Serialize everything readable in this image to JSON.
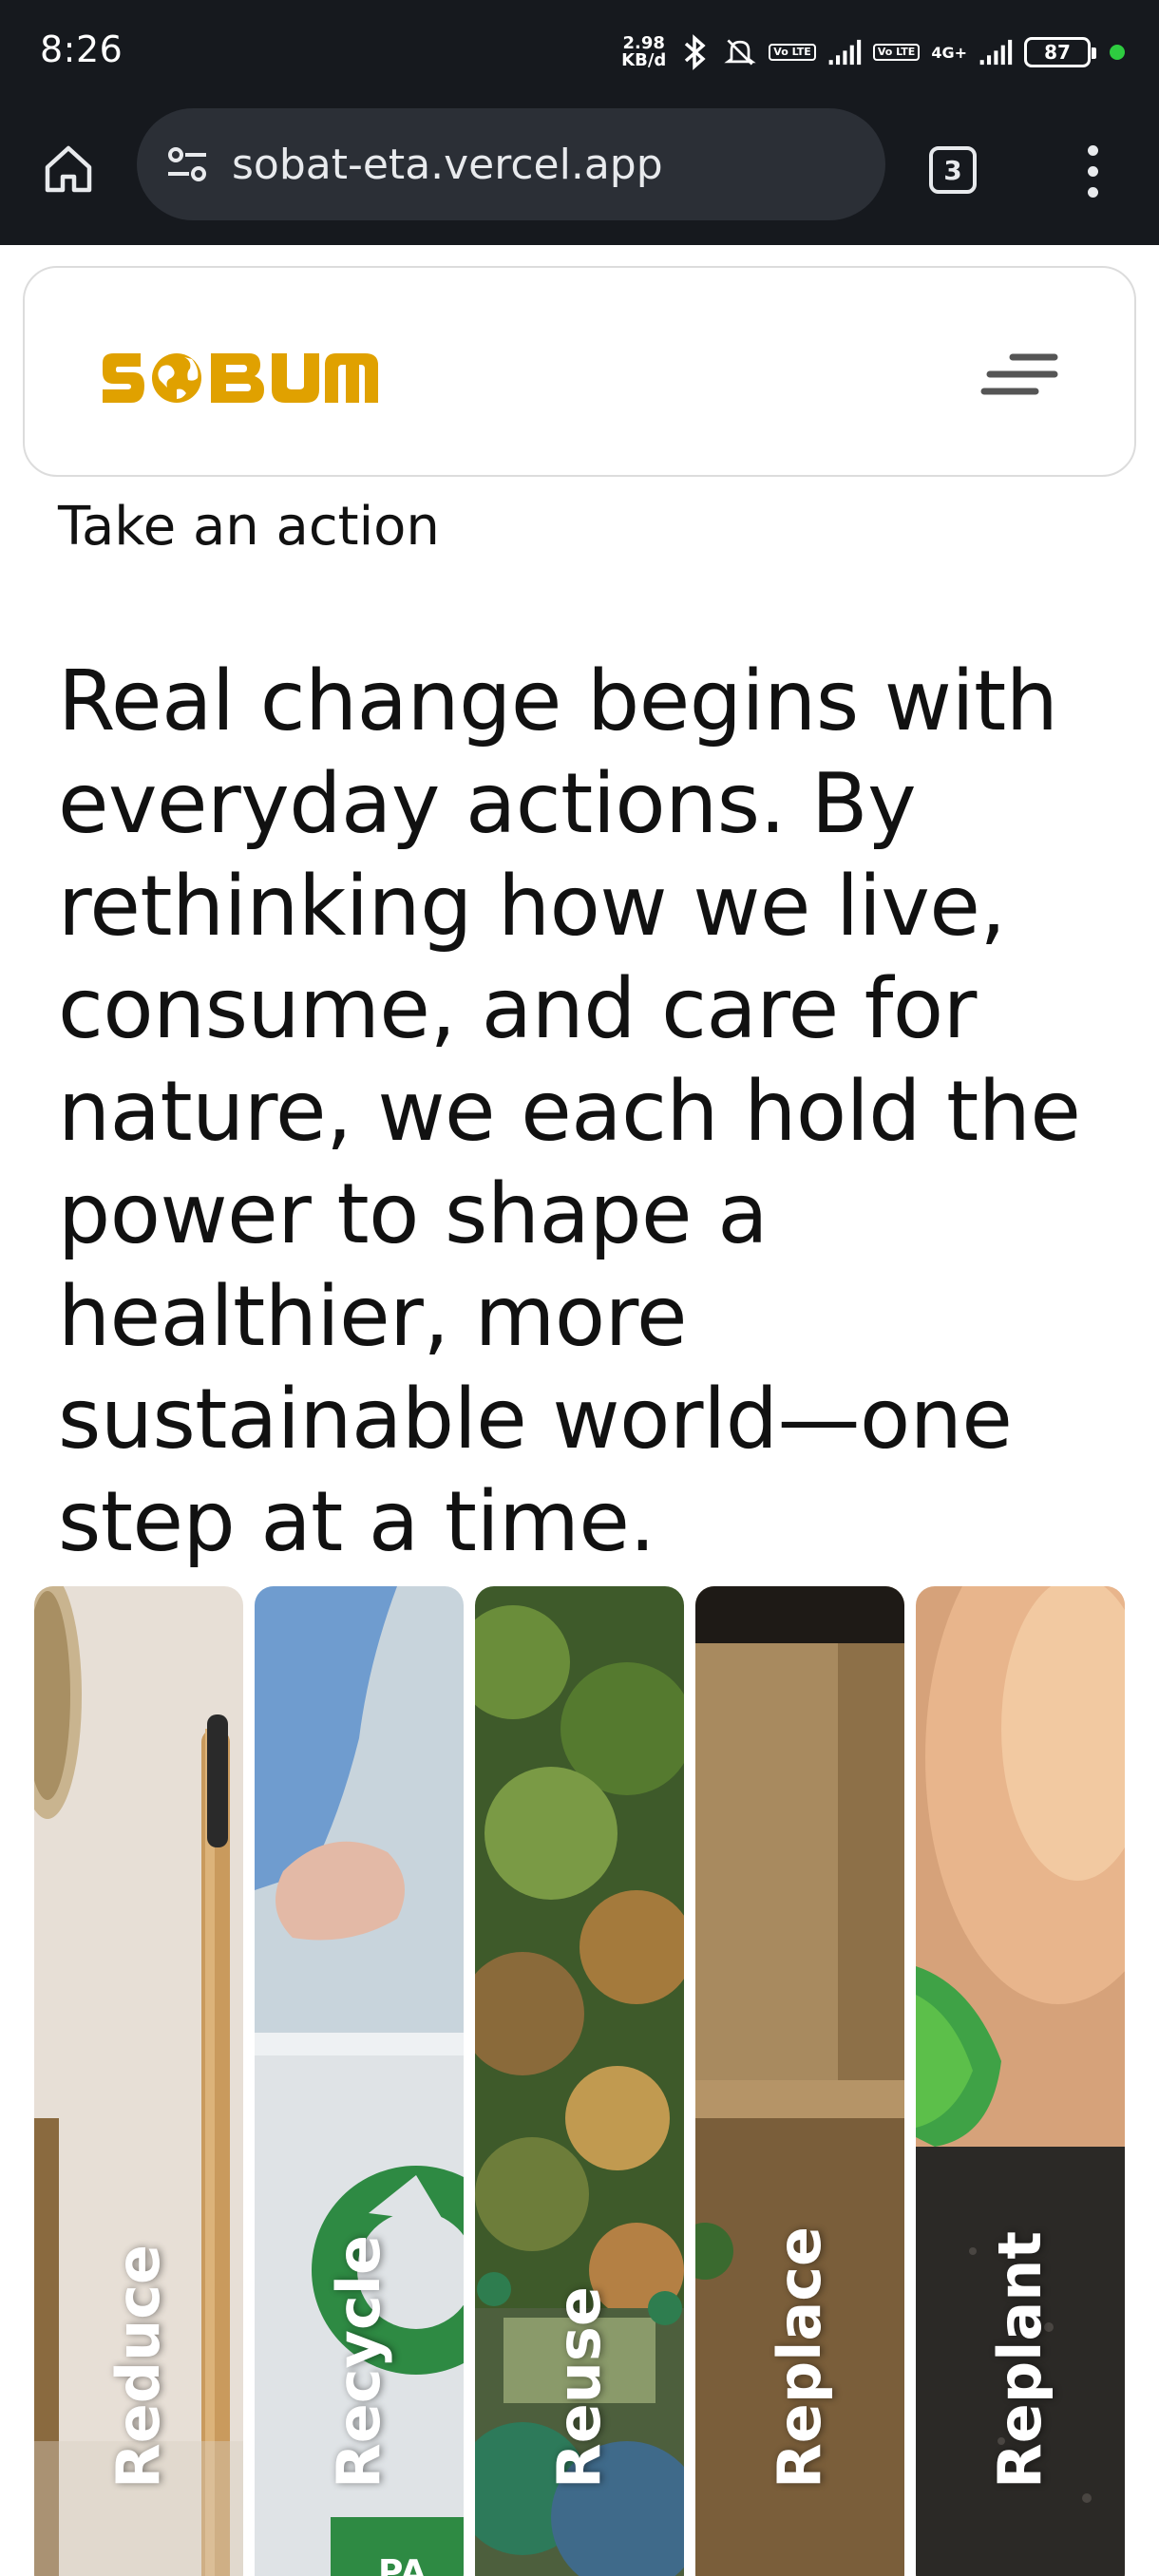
{
  "status_bar": {
    "time": "8:26",
    "net_speed_value": "2.98",
    "net_speed_unit": "KB/d",
    "volte_label": "Vo LTE",
    "network_type": "4G+",
    "battery": "87",
    "icons": [
      "bluetooth-icon",
      "mute-icon",
      "signal-icon",
      "battery-icon"
    ]
  },
  "browser": {
    "url": "sobat-eta.vercel.app",
    "tab_count": "3",
    "icons": [
      "home-icon",
      "site-settings-icon",
      "tabs-icon",
      "more-vert-icon"
    ]
  },
  "header": {
    "logo_text": "SOBUM",
    "logo_color": "#e0a100",
    "menu_icon": "hamburger-icon"
  },
  "main": {
    "section_label": "Take an action",
    "headline": "Real change begins with everyday actions. By rethinking how we live, consume, and care for nature, we each hold the power to shape a healthier, more sustainable world—one step at a time.",
    "cards": [
      {
        "label": "Reduce"
      },
      {
        "label": "Recycle"
      },
      {
        "label": "Reuse"
      },
      {
        "label": "Replace"
      },
      {
        "label": "Replant"
      }
    ]
  }
}
